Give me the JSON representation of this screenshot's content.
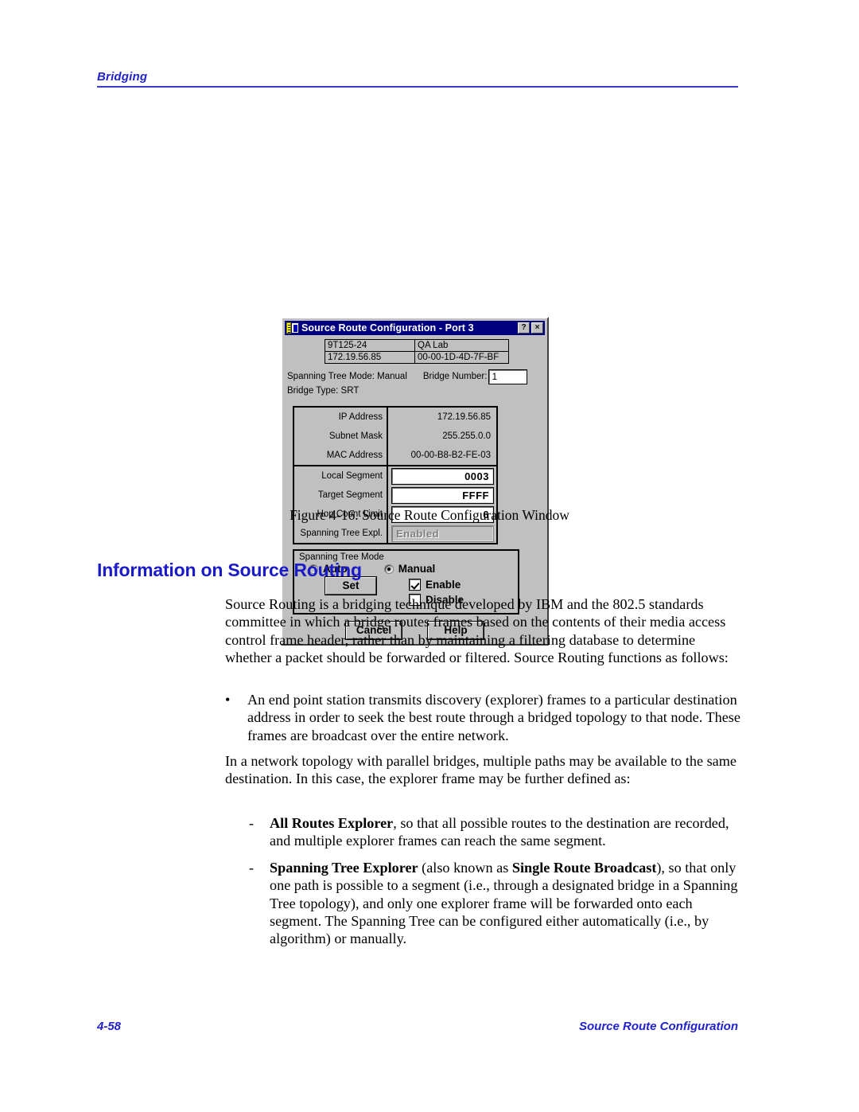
{
  "header": {
    "chapter": "Bridging"
  },
  "footer": {
    "page_number": "4-58",
    "section": "Source Route Configuration"
  },
  "figure": {
    "caption": "Figure 4-16.  Source Route Configuration Window",
    "dialog": {
      "title": "Source Route Configuration - Port 3",
      "help_button": "?",
      "close_button": "×",
      "info_table": [
        {
          "left": "9T125-24",
          "right": "QA Lab"
        },
        {
          "left": "172.19.56.85",
          "right": "00-00-1D-4D-7F-BF"
        }
      ],
      "spanning_tree_mode_label": "Spanning Tree Mode:  Manual",
      "bridge_number_label": "Bridge Number:",
      "bridge_number_value": "1",
      "bridge_type_label": "Bridge Type:  SRT",
      "readonly_rows": [
        {
          "label": "IP Address",
          "value": "172.19.56.85"
        },
        {
          "label": "Subnet Mask",
          "value": "255.255.0.0"
        },
        {
          "label": "MAC Address",
          "value": "00-00-B8-B2-FE-03"
        }
      ],
      "editable_rows": [
        {
          "label": "Local Segment",
          "value": "0003",
          "disabled": false
        },
        {
          "label": "Target Segment",
          "value": "FFFF",
          "disabled": false
        },
        {
          "label": "Hop Count Limit",
          "value": "6",
          "disabled": false
        },
        {
          "label": "Spanning Tree Expl.",
          "value": "Enabled",
          "disabled": true
        }
      ],
      "group": {
        "title": "Spanning Tree Mode",
        "radio_auto": "Auto",
        "radio_manual": "Manual",
        "set_button": "Set",
        "check_enable": "Enable",
        "check_disable": "Disable"
      },
      "buttons": {
        "cancel": "Cancel",
        "help": "Help"
      },
      "colors": {
        "titlebar": "#000080",
        "face": "#c0c0c0",
        "field": "#ffffff",
        "disabled_text": "#808080"
      }
    }
  },
  "content": {
    "heading": "Information on Source Routing",
    "paragraph_1": "Source Routing is a bridging technique developed by IBM and the 802.5 standards committee in which a bridge routes frames based on the contents of their media access control frame header, rather than by maintaining a filtering database to determine whether a packet should be forwarded or filtered. Source Routing functions as follows:",
    "bullet_mark": "•",
    "bullet_1": "An end point station transmits discovery (explorer) frames to a particular destination address in order to seek the best route through a bridged topology to that node. These frames are broadcast over the entire network.",
    "paragraph_2": "In a network topology with parallel bridges, multiple paths may be available to the same destination. In this case, the explorer frame may be further defined as:",
    "dash_mark": "-",
    "dash_1_bold": "All Routes Explorer",
    "dash_1_rest": ", so that all possible routes to the destination are recorded, and multiple explorer frames can reach the same segment.",
    "dash_2_bold_a": "Spanning Tree Explorer",
    "dash_2_mid": " (also known as ",
    "dash_2_bold_b": "Single Route Broadcast",
    "dash_2_rest": "), so that only one path is possible to a segment (i.e., through a designated bridge in a Spanning Tree topology), and only one explorer frame will be forwarded onto each segment. The Spanning Tree can be configured either automatically (i.e., by algorithm) or manually."
  },
  "theme": {
    "accent_blue": "#2222cc",
    "heading_blue": "#1a1ac8"
  }
}
